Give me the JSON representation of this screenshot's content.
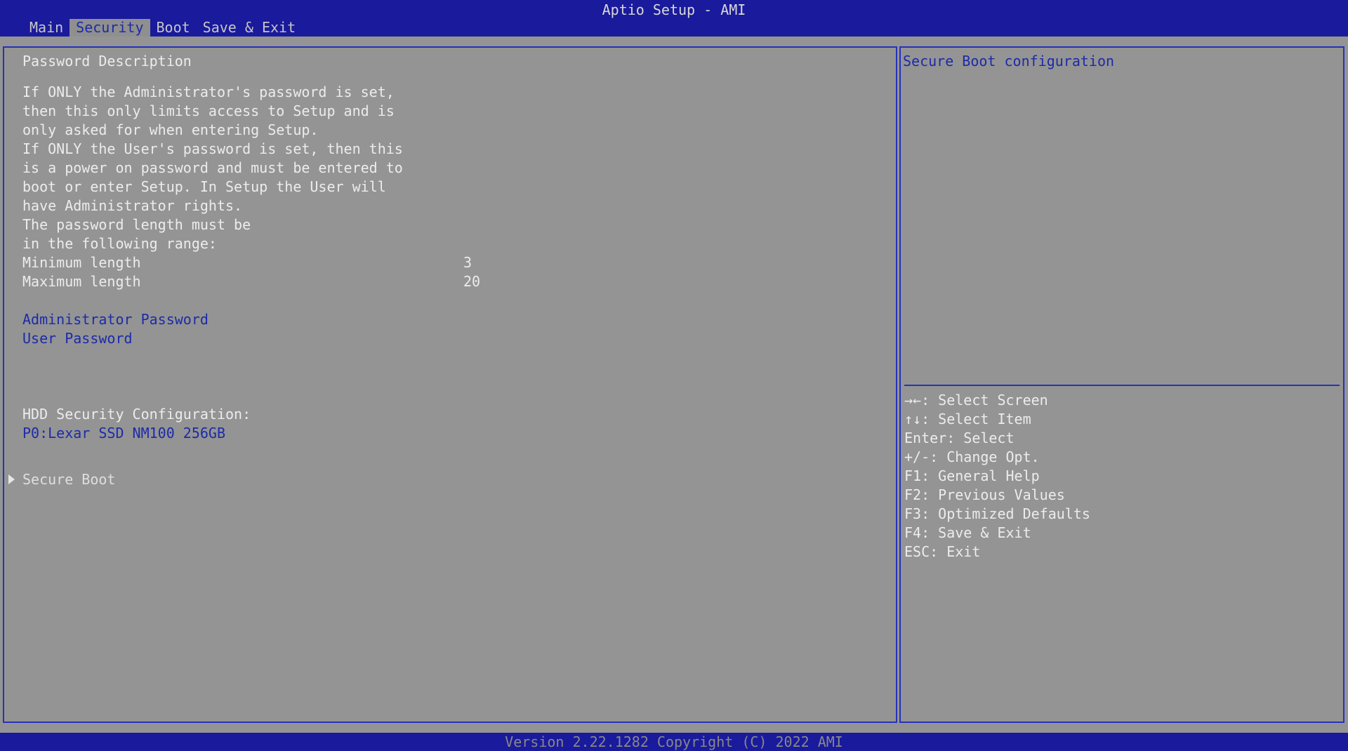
{
  "app_title": "Aptio Setup - AMI",
  "tabs": [
    {
      "label": "Main"
    },
    {
      "label": "Security"
    },
    {
      "label": "Boot"
    },
    {
      "label": "Save & Exit"
    }
  ],
  "active_tab": "Security",
  "main": {
    "heading": "Password Description",
    "description": [
      "If ONLY the Administrator's password is set,",
      "then this only limits access to Setup and is",
      "only asked for when entering Setup.",
      "If ONLY the User's password is set, then this",
      "is a power on password and must be entered to",
      "boot or enter Setup. In Setup the User will",
      "have Administrator rights.",
      "The password length must be",
      "in the following range:"
    ],
    "min_length_label": "Minimum length",
    "min_length_value": "3",
    "max_length_label": "Maximum length",
    "max_length_value": "20",
    "admin_password_label": "Administrator Password",
    "user_password_label": "User Password",
    "hdd_config_label": "HDD Security Configuration:",
    "hdd_device_label": "P0:Lexar SSD NM100 256GB",
    "secure_boot_label": "Secure Boot"
  },
  "help": {
    "description": "Secure Boot configuration",
    "keys": [
      "→←: Select Screen",
      "↑↓: Select Item",
      "Enter: Select",
      "+/-: Change Opt.",
      "F1: General Help",
      "F2: Previous Values",
      "F3: Optimized Defaults",
      "F4: Save & Exit",
      "ESC: Exit"
    ]
  },
  "footer": {
    "version": "Version 2.22.1282 Copyright (C) 2022 AMI"
  },
  "colors": {
    "bar_background": "#1a1a9c",
    "pane_background": "#949494",
    "border": "#2632b8",
    "link_text": "#1c2ba8",
    "normal_text": "#ececec"
  },
  "icons": {
    "submenu_arrow": "triangle-right-icon"
  }
}
